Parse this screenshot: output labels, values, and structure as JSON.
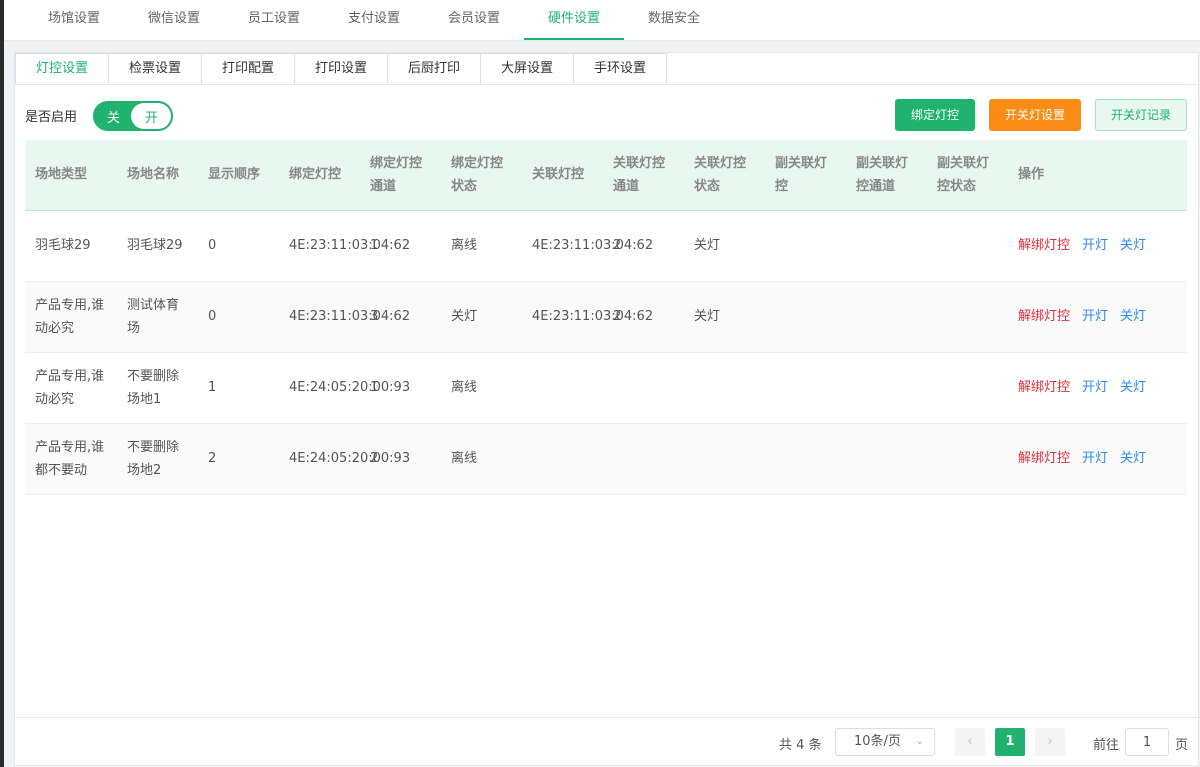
{
  "topnav": [
    "场馆设置",
    "微信设置",
    "员工设置",
    "支付设置",
    "会员设置",
    "硬件设置",
    "数据安全"
  ],
  "subtabs": [
    "灯控设置",
    "检票设置",
    "打印配置",
    "打印设置",
    "后厨打印",
    "大屏设置",
    "手环设置"
  ],
  "enable": {
    "label": "是否启用",
    "off": "关",
    "on": "开"
  },
  "buttons": {
    "bind": "绑定灯控",
    "switch_setting": "开关灯设置",
    "switch_record": "开关灯记录"
  },
  "table": {
    "headers": [
      "场地类型",
      "场地名称",
      "显示顺序",
      "绑定灯控",
      "绑定灯控通道",
      "绑定灯控状态",
      "关联灯控",
      "关联灯控通道",
      "关联灯控状态",
      "副关联灯控",
      "副关联灯控通道",
      "副关联灯控状态",
      "操作"
    ],
    "rows": [
      [
        "羽毛球29",
        "羽毛球29",
        "0",
        "4E:23:11:03:04:62",
        "1",
        "离线",
        "4E:23:11:03:04:62",
        "2",
        "关灯",
        "",
        "",
        ""
      ],
      [
        "产品专用,谁动必究",
        "测试体育场",
        "0",
        "4E:23:11:03:04:62",
        "3",
        "关灯",
        "4E:23:11:03:04:62",
        "2",
        "关灯",
        "",
        "",
        ""
      ],
      [
        "产品专用,谁动必究",
        "不要删除场地1",
        "1",
        "4E:24:05:20:00:93",
        "1",
        "离线",
        "",
        "",
        "",
        "",
        "",
        ""
      ],
      [
        "产品专用,谁都不要动",
        "不要删除场地2",
        "2",
        "4E:24:05:20:00:93",
        "2",
        "离线",
        "",
        "",
        "",
        "",
        "",
        ""
      ]
    ],
    "ops": [
      "解绑灯控",
      "开灯",
      "关灯"
    ]
  },
  "pager": {
    "total": "共 4 条",
    "pagesize": "10条/页",
    "current": "1",
    "goto_label": "前往",
    "goto_value": "1",
    "goto_suffix": "页"
  },
  "colors": {
    "accent": "#1fb36f",
    "orange": "#fa8c16",
    "unbind": "#e0303a",
    "link": "#2d8cf0"
  }
}
